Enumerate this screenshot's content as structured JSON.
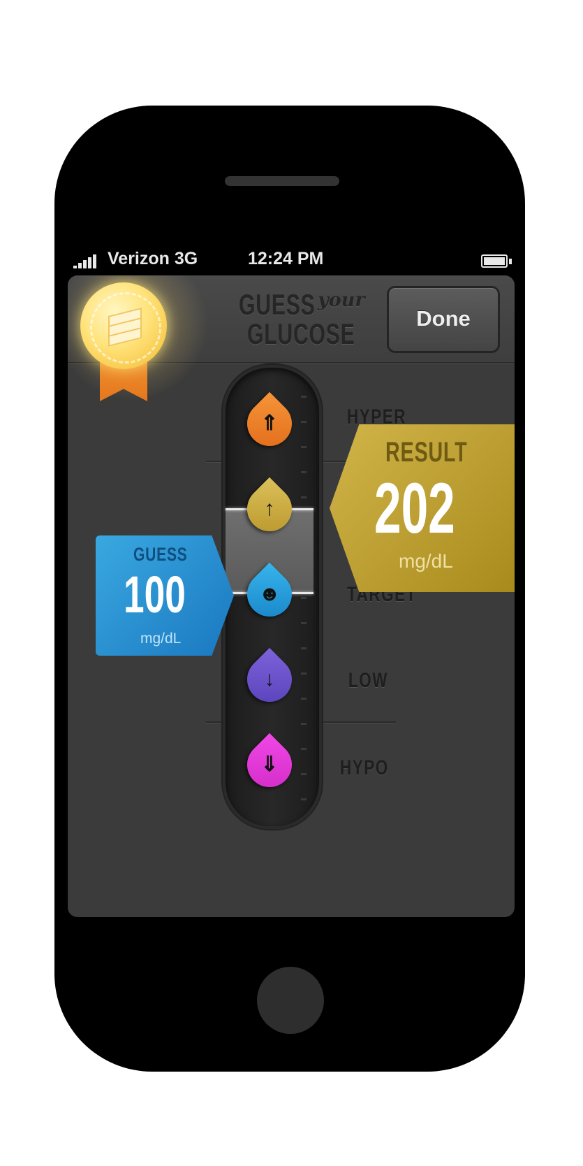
{
  "status_bar": {
    "carrier": "Verizon",
    "network": "3G",
    "time": "12:24 PM"
  },
  "header": {
    "title_line1": "GUESS",
    "title_connector": "your",
    "title_line2": "GLUCOSE",
    "done_label": "Done"
  },
  "zones": {
    "hyper": "HYPER",
    "target": "TARGET",
    "low": "LOW",
    "hypo": "HYPO"
  },
  "guess": {
    "label": "GUESS",
    "value": "100",
    "unit": "mg/dL"
  },
  "result": {
    "label": "RESULT",
    "value": "202",
    "unit": "mg/dL"
  },
  "drops": [
    {
      "name": "hyper",
      "color": "#f07f22",
      "icon": "double-arrow-up-icon"
    },
    {
      "name": "high",
      "color": "#c8aa3b",
      "icon": "arrow-up-icon"
    },
    {
      "name": "target",
      "color": "#1f9ad8",
      "icon": "smiley-face-icon"
    },
    {
      "name": "low",
      "color": "#6a4fc9",
      "icon": "arrow-down-icon"
    },
    {
      "name": "hypo",
      "color": "#e63bd9",
      "icon": "double-arrow-down-icon"
    }
  ]
}
